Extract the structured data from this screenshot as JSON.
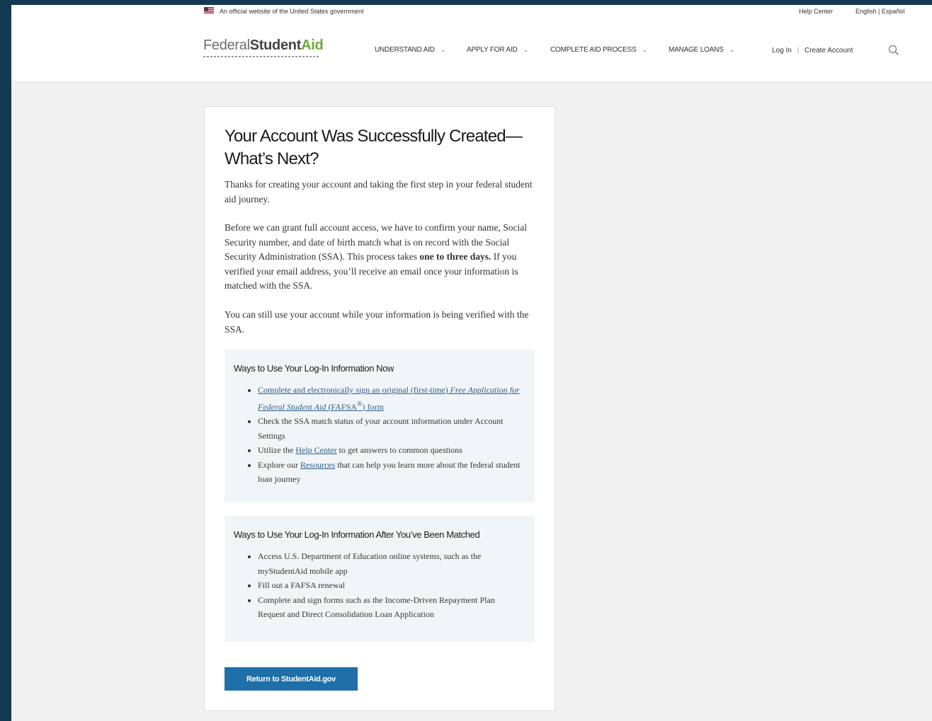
{
  "gov_banner": {
    "text": "An official website of the United States government",
    "help_center": "Help Center",
    "language": "English | Español"
  },
  "header": {
    "logo": {
      "part1": "Federal",
      "part2": "Student",
      "part3": "Aid"
    },
    "nav": [
      {
        "label": "Understand Aid"
      },
      {
        "label": "Apply for Aid"
      },
      {
        "label": "Complete Aid Process"
      },
      {
        "label": "Manage Loans"
      }
    ],
    "login": "Log In",
    "separator": "|",
    "create_account": "Create Account",
    "search_icon": "search-icon"
  },
  "card": {
    "title": "Your Account Was Successfully Created—What’s Next?",
    "p1": "Thanks for creating your account and taking the first step in your federal student aid journey.",
    "p2": {
      "a": "Before we can grant full account access, we have to confirm your name, Social Security number, and date of birth match what is on record with the Social Security Administration (SSA). This process takes ",
      "b": "one to three days.",
      "c": " If you verified your email address, you’ll receive an email once your information is matched with the SSA."
    },
    "p3": "You can still use your account while your information is being verified with the SSA.",
    "box1": {
      "title": "Ways to Use Your Log-In Information Now",
      "items": {
        "i1": {
          "link_a": "Complete and electronically sign an original (first-time) ",
          "link_b": "Free Application for Federal Student Aid",
          "link_c": " (FAFSA",
          "link_sup": "®",
          "link_d": ") form"
        },
        "i2": {
          "text": "Check the SSA match status of your account information under Account Settings"
        },
        "i3": {
          "pre": "Utilize the ",
          "link": "Help Center",
          "post": " to get answers to common questions"
        },
        "i4": {
          "pre": "Explore our ",
          "link": "Resources",
          "post": " that can help you learn more about the federal student loan journey"
        }
      }
    },
    "box2": {
      "title": "Ways to Use Your Log-In Information After You’ve Been Matched",
      "items": [
        "Access U.S. Department of Education online systems, such as the myStudentAid mobile app",
        "Fill out a FAFSA renewal",
        "Complete and sign forms such as the Income-Driven Repayment Plan Request and Direct Consolidation Loan Application"
      ]
    },
    "button": "Return to StudentAid.gov"
  }
}
